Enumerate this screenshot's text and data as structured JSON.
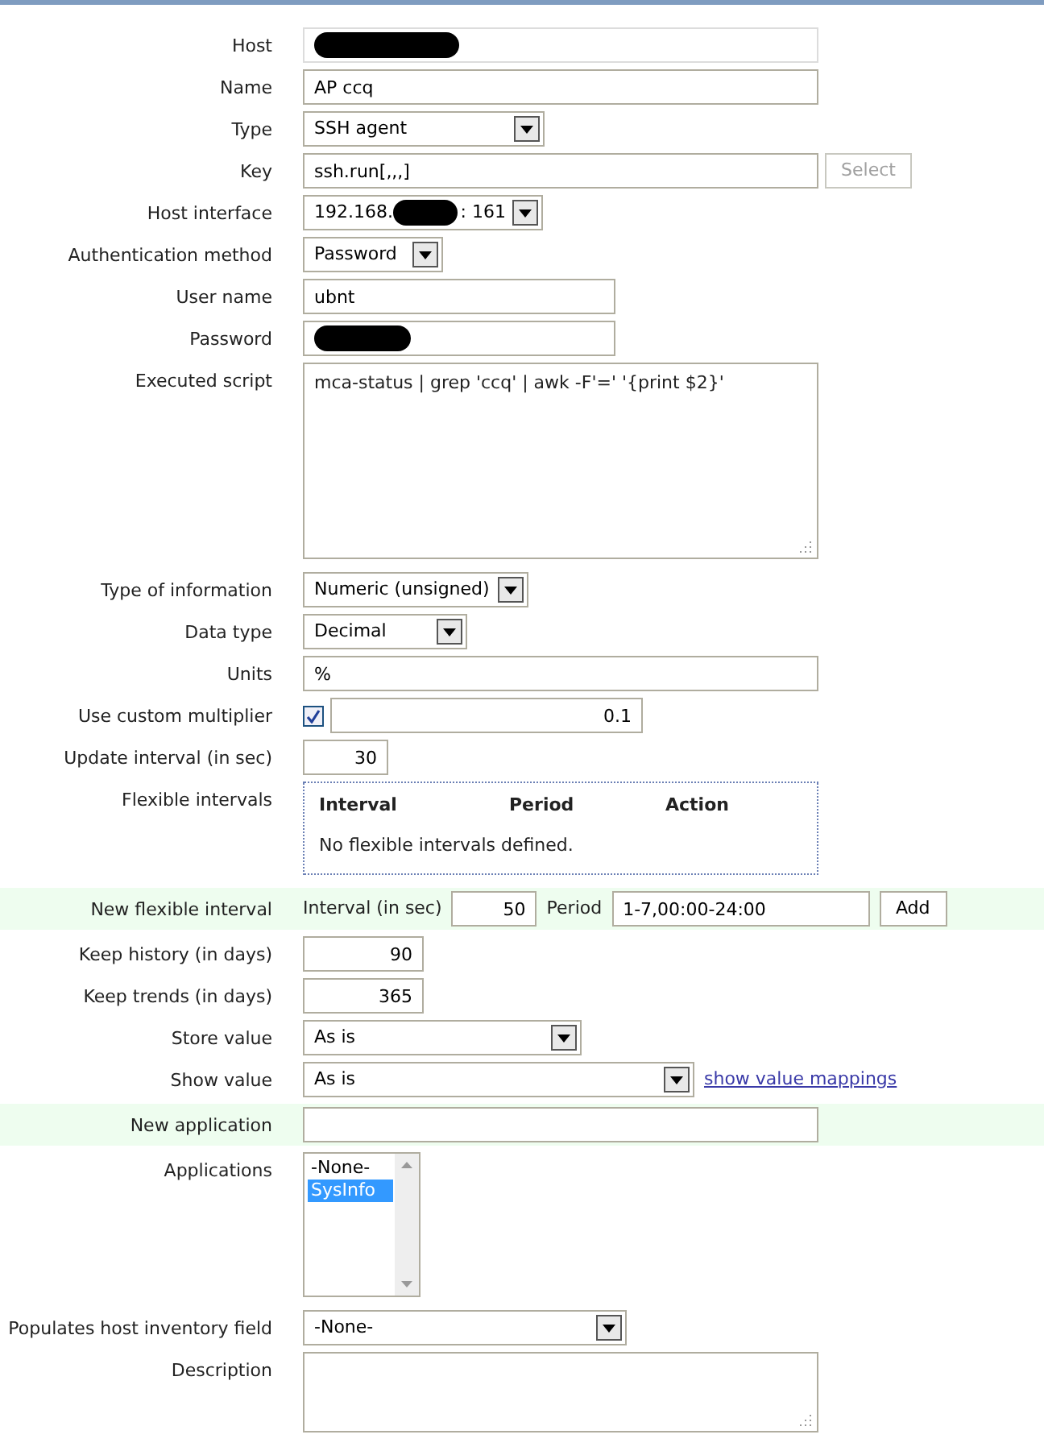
{
  "rows": [
    {
      "kind": "redacted",
      "label": "Host",
      "readonly": true
    },
    {
      "kind": "text",
      "label": "Name",
      "value": "AP ccq"
    },
    {
      "kind": "select",
      "label": "Type",
      "value": "SSH agent"
    },
    {
      "kind": "text_button",
      "label": "Key",
      "value": "ssh.run[,,,]",
      "button": {
        "label": "Select",
        "disabled": true
      }
    },
    {
      "kind": "interface",
      "label": "Host interface",
      "value_start": "192.168.",
      "value_end": ": 161"
    },
    {
      "kind": "select",
      "label": "Authentication method",
      "value": "Password"
    },
    {
      "kind": "text",
      "label": "User name",
      "value": "ubnt"
    },
    {
      "kind": "redacted",
      "label": "Password",
      "readonly": false
    },
    {
      "kind": "textarea",
      "label": "Executed script",
      "value": "mca-status | grep 'ccq' | awk -F'=' '{print $2}'"
    },
    {
      "kind": "select",
      "label": "Type of information",
      "value": "Numeric (unsigned)"
    },
    {
      "kind": "select",
      "label": "Data type",
      "value": "Decimal"
    },
    {
      "kind": "text",
      "label": "Units",
      "value": "%"
    },
    {
      "kind": "checkbox_text",
      "label": "Use custom multiplier",
      "checked": true,
      "value": "0.1"
    },
    {
      "kind": "number",
      "label": "Update interval (in sec)",
      "value": "30"
    },
    {
      "kind": "intervals",
      "label": "Flexible intervals",
      "columns": [
        "Interval",
        "Period",
        "Action"
      ],
      "empty_text": "No flexible intervals defined."
    },
    {
      "kind": "new_interval",
      "label": "New flexible interval",
      "highlighted": true,
      "interval_label": "Interval (in sec)",
      "interval": "50",
      "period_label": "Period",
      "period": "1-7,00:00-24:00",
      "button": "Add"
    },
    {
      "kind": "number",
      "label": "Keep history (in days)",
      "value": "90"
    },
    {
      "kind": "number",
      "label": "Keep trends (in days)",
      "value": "365"
    },
    {
      "kind": "select",
      "label": "Store value",
      "value": "As is"
    },
    {
      "kind": "select_link",
      "label": "Show value",
      "value": "As is",
      "link": "show value mappings"
    },
    {
      "kind": "text",
      "label": "New application",
      "value": "",
      "highlighted": true
    },
    {
      "kind": "listbox",
      "label": "Applications",
      "items": [
        {
          "label": "-None-",
          "selected": false
        },
        {
          "label": "SysInfo",
          "selected": true
        }
      ]
    },
    {
      "kind": "select",
      "label": "Populates host inventory field",
      "value": "-None-"
    },
    {
      "kind": "textarea",
      "label": "Description",
      "value": ""
    }
  ]
}
